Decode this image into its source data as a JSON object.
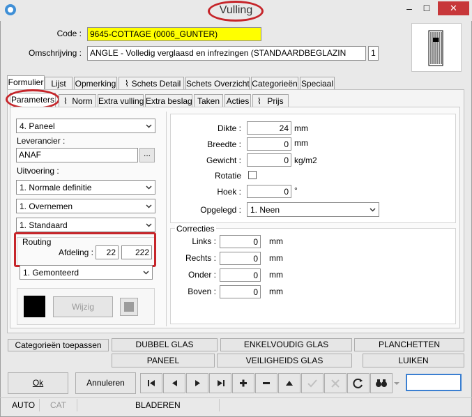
{
  "window": {
    "title": "Vulling",
    "minimize_glyph": "–",
    "maximize_glyph": "□",
    "close_glyph": "✕"
  },
  "header": {
    "code_label": "Code :",
    "code_value": "9645-COTTAGE (0006_GUNTER)",
    "omschrijving_label": "Omschrijving :",
    "omschrijving_value": "ANGLE - Volledig verglaasd en infrezingen (STANDAARDBEGLAZIN",
    "omschrijving_count": "1"
  },
  "tabs_main": [
    "Formulier",
    "Lijst",
    "Opmerking",
    "Schets Detail",
    "Schets Overzicht",
    "Categorieën",
    "Speciaal"
  ],
  "tabs_sub": [
    "Parameters",
    "Norm",
    "Extra vulling",
    "Extra beslag",
    "Taken",
    "Acties",
    "Prijs"
  ],
  "left": {
    "type_select": "4.  Paneel",
    "leverancier_label": "Leverancier :",
    "leverancier_value": "ANAF",
    "browse_label": "...",
    "uitvoering_label": "Uitvoering :",
    "uitvoering_select1": "1.  Normale definitie",
    "uitvoering_select2": "1.  Overnemen",
    "uitvoering_select3": "1.  Standaard",
    "routing_label": "Routing",
    "afdeling_label": "Afdeling :",
    "afdeling_value1": "22",
    "afdeling_value2": "222",
    "gemonteerd_select": "1.  Gemonteerd",
    "wijzig_label": "Wijzig",
    "swatch_color": "#000000"
  },
  "right": {
    "dikte_label": "Dikte :",
    "dikte_value": "24",
    "dikte_unit": "mm",
    "breedte_label": "Breedte :",
    "breedte_value": "0",
    "breedte_unit": "mm",
    "gewicht_label": "Gewicht :",
    "gewicht_value": "0",
    "gewicht_unit": "kg/m2",
    "rotatie_label": "Rotatie",
    "hoek_label": "Hoek :",
    "hoek_value": "0",
    "hoek_unit": "°",
    "opgelegd_label": "Opgelegd :",
    "opgelegd_value": "1.  Neen",
    "correcties_label": "Correcties",
    "links_label": "Links :",
    "links_value": "0",
    "links_unit": "mm",
    "rechts_label": "Rechts :",
    "rechts_value": "0",
    "rechts_unit": "mm",
    "onder_label": "Onder :",
    "onder_value": "0",
    "onder_unit": "mm",
    "boven_label": "Boven :",
    "boven_value": "0",
    "boven_unit": "mm"
  },
  "buttons_row1": {
    "categorieen": "Categorieën toepassen",
    "dubbel": "DUBBEL GLAS",
    "enkel": "ENKELVOUDIG GLAS",
    "planchetten": "PLANCHETTEN"
  },
  "buttons_row2": {
    "paneel": "PANEEL",
    "veiligheids": "VEILIGHEIDS GLAS",
    "luiken": "LUIKEN"
  },
  "bottom": {
    "ok": "Ok",
    "annuleren": "Annuleren"
  },
  "status": {
    "mode": "AUTO",
    "cat": "CAT",
    "state": "BLADEREN"
  },
  "colors": {
    "highlight_yellow": "#ffff00",
    "annotation_red": "#c6252a"
  }
}
